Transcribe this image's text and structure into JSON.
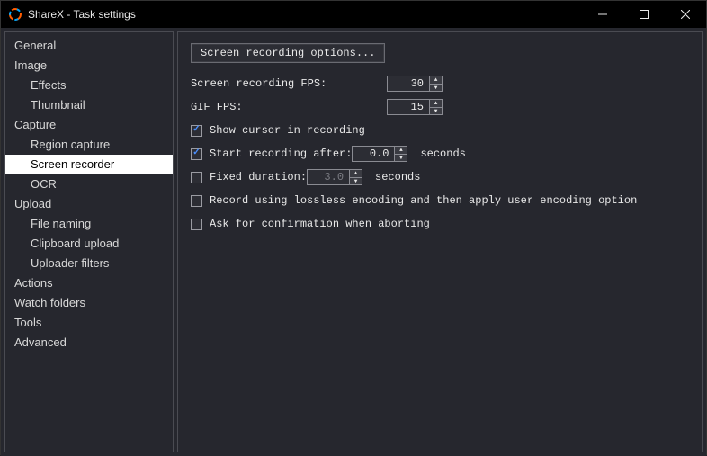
{
  "window": {
    "title": "ShareX - Task settings"
  },
  "sidebar": {
    "items": [
      {
        "label": "General",
        "child": false
      },
      {
        "label": "Image",
        "child": false
      },
      {
        "label": "Effects",
        "child": true
      },
      {
        "label": "Thumbnail",
        "child": true
      },
      {
        "label": "Capture",
        "child": false
      },
      {
        "label": "Region capture",
        "child": true
      },
      {
        "label": "Screen recorder",
        "child": true,
        "selected": true
      },
      {
        "label": "OCR",
        "child": true
      },
      {
        "label": "Upload",
        "child": false
      },
      {
        "label": "File naming",
        "child": true
      },
      {
        "label": "Clipboard upload",
        "child": true
      },
      {
        "label": "Uploader filters",
        "child": true
      },
      {
        "label": "Actions",
        "child": false
      },
      {
        "label": "Watch folders",
        "child": false
      },
      {
        "label": "Tools",
        "child": false
      },
      {
        "label": "Advanced",
        "child": false
      }
    ]
  },
  "main": {
    "options_button": "Screen recording options...",
    "fps_label": "Screen recording FPS:",
    "fps_value": "30",
    "gif_label": "GIF FPS:",
    "gif_value": "15",
    "show_cursor": {
      "checked": true,
      "label": "Show cursor in recording"
    },
    "start_after": {
      "checked": true,
      "label": "Start recording after:",
      "value": "0.0",
      "unit": "seconds"
    },
    "fixed_duration": {
      "checked": false,
      "label": "Fixed duration:",
      "value": "3.0",
      "unit": "seconds"
    },
    "lossless": {
      "checked": false,
      "label": "Record using lossless encoding and then apply user encoding option"
    },
    "confirm_abort": {
      "checked": false,
      "label": "Ask for confirmation when aborting"
    }
  }
}
